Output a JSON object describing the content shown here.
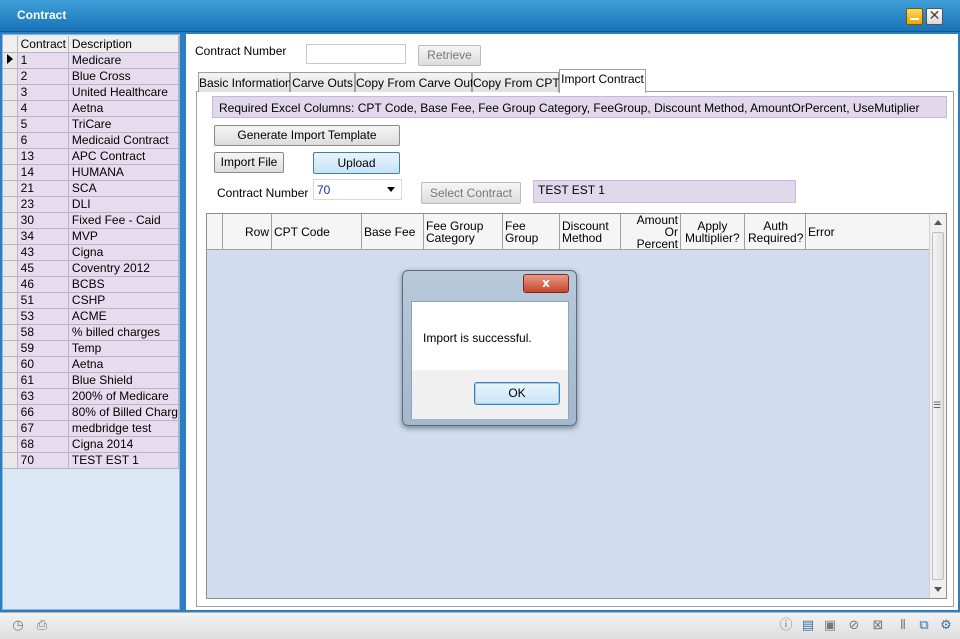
{
  "window": {
    "title": "Contract",
    "minimize_icon": "minimize-icon",
    "close_glyph": "✕"
  },
  "contract_list": {
    "columns": [
      "Contract",
      "Description"
    ],
    "selected_row": 0,
    "rows": [
      {
        "contract": "1",
        "description": "Medicare"
      },
      {
        "contract": "2",
        "description": "Blue Cross"
      },
      {
        "contract": "3",
        "description": "United Healthcare"
      },
      {
        "contract": "4",
        "description": "Aetna"
      },
      {
        "contract": "5",
        "description": "TriCare"
      },
      {
        "contract": "6",
        "description": "Medicaid Contract"
      },
      {
        "contract": "13",
        "description": "APC Contract"
      },
      {
        "contract": "14",
        "description": "HUMANA"
      },
      {
        "contract": "21",
        "description": "SCA"
      },
      {
        "contract": "23",
        "description": "DLI"
      },
      {
        "contract": "30",
        "description": "Fixed Fee - Caid"
      },
      {
        "contract": "34",
        "description": "MVP"
      },
      {
        "contract": "43",
        "description": "Cigna"
      },
      {
        "contract": "45",
        "description": "Coventry 2012"
      },
      {
        "contract": "46",
        "description": "BCBS"
      },
      {
        "contract": "51",
        "description": "CSHP"
      },
      {
        "contract": "53",
        "description": "ACME"
      },
      {
        "contract": "58",
        "description": "% billed charges"
      },
      {
        "contract": "59",
        "description": "Temp"
      },
      {
        "contract": "60",
        "description": "Aetna"
      },
      {
        "contract": "61",
        "description": "Blue Shield"
      },
      {
        "contract": "63",
        "description": "200% of Medicare"
      },
      {
        "contract": "66",
        "description": "80% of Billed Charg"
      },
      {
        "contract": "67",
        "description": "medbridge test"
      },
      {
        "contract": "68",
        "description": "Cigna 2014"
      },
      {
        "contract": "70",
        "description": "TEST EST 1"
      }
    ]
  },
  "header": {
    "contract_number_label": "Contract Number",
    "contract_number_value": "",
    "retrieve_label": "Retrieve"
  },
  "tabs": [
    {
      "label": "Basic Information",
      "active": false
    },
    {
      "label": "Carve Outs",
      "active": false
    },
    {
      "label": "Copy From Carve Outs",
      "active": false
    },
    {
      "label": "Copy From CPT",
      "active": false
    },
    {
      "label": "Import Contract",
      "active": true
    }
  ],
  "import": {
    "required_columns_text": "Required Excel Columns: CPT Code, Base Fee, Fee Group Category, FeeGroup, Discount Method, AmountOrPercent,  UseMutiplier",
    "generate_template_label": "Generate Import Template",
    "import_file_label": "Import File",
    "upload_label": "Upload",
    "contract_number_label": "Contract Number",
    "contract_number_selected": "70",
    "select_contract_label": "Select Contract",
    "selected_contract_name": "TEST EST 1"
  },
  "import_grid": {
    "columns": [
      "Row",
      "CPT Code",
      "Base Fee",
      "Fee Group\nCategory",
      "Fee\nGroup",
      "Discount\nMethod",
      "Amount\nOr\nPercent",
      "Apply\nMultiplier?",
      "Auth\nRequired?",
      "Error"
    ],
    "rows": []
  },
  "dialog": {
    "close_glyph": "x",
    "message": "Import is successful.",
    "ok_label": "OK"
  },
  "statusbar": {
    "icons": [
      "clock-icon",
      "print-icon",
      "info-icon",
      "document-icon",
      "save-icon",
      "cancel-icon",
      "delete-icon",
      "grip-icon",
      "copy-icon",
      "settings-icon"
    ]
  },
  "colors": {
    "titlebar": "#1a73b9",
    "grid_body": "#cfddef",
    "list_cell": "#e6dcee",
    "info_bar": "#e1d8ec"
  }
}
